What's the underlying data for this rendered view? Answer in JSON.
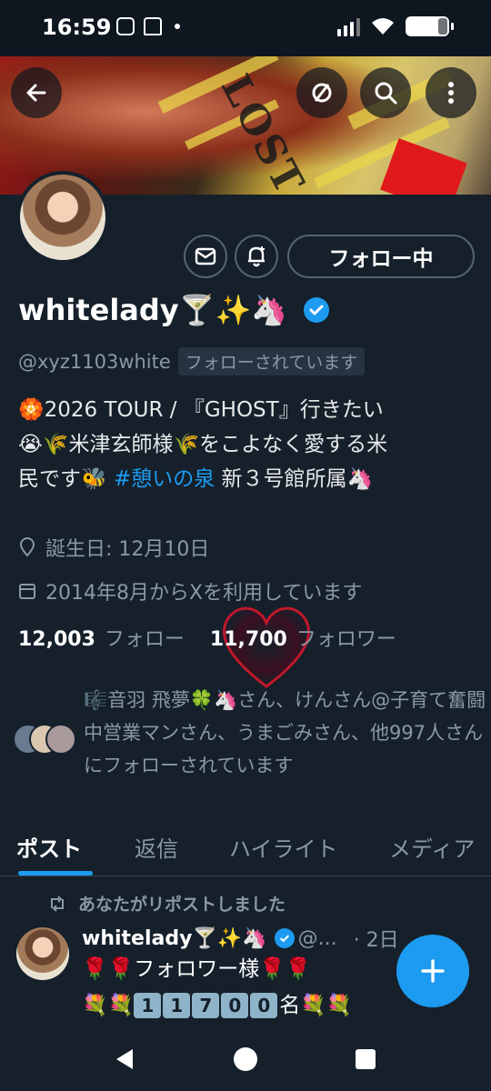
{
  "status_bar": {
    "time": "16:59"
  },
  "profile": {
    "display_name": "whitelady🍸✨🦄",
    "handle": "@xyz1103white",
    "follows_you": "フォローされています",
    "follow_button": "フォロー中",
    "bio_lines": [
      "🏵️2026 TOUR / 『GHOST』行きたい",
      "😭🌾米津玄師様🌾をこよなく愛する米",
      "民です🐝"
    ],
    "bio_hashtag": "#憩いの泉",
    "bio_suffix": "新３号館所属🦄",
    "birthday": "誕生日: 12月10日",
    "joined": "2014年8月からXを利用しています",
    "following_count": "12,003",
    "following_label": "フォロー",
    "followers_count": "11,700",
    "followers_label": "フォロワー",
    "followed_by_text": "🎼音羽 飛夢🍀🦄さん、けんさん@子育て奮闘中営業マンさん、うまごみさん、他997人さんにフォローされています"
  },
  "tabs": [
    "ポスト",
    "返信",
    "ハイライト",
    "メディア"
  ],
  "post": {
    "repost_label": "あなたがリポストしました",
    "author": "whitelady🍸✨🦄",
    "handle_trunc": "@...",
    "time": "· 2日",
    "line1": "🌹🌹フォロワー様🌹🌹",
    "digits": [
      "1",
      "1",
      "7",
      "0",
      "0"
    ],
    "digits_suffix": "名",
    "line2_prefix": "💐💐",
    "line2_suffix": "💐💐"
  },
  "icons": [
    "back-arrow-icon",
    "mute-icon",
    "search-icon",
    "more-icon",
    "message-icon",
    "notification-bell-icon",
    "verified-badge-icon",
    "location-icon",
    "calendar-icon",
    "repost-icon",
    "compose-plus-icon"
  ],
  "colors": {
    "accent": "#1d9bf0",
    "background": "#15202b",
    "muted": "#8b98a5"
  }
}
